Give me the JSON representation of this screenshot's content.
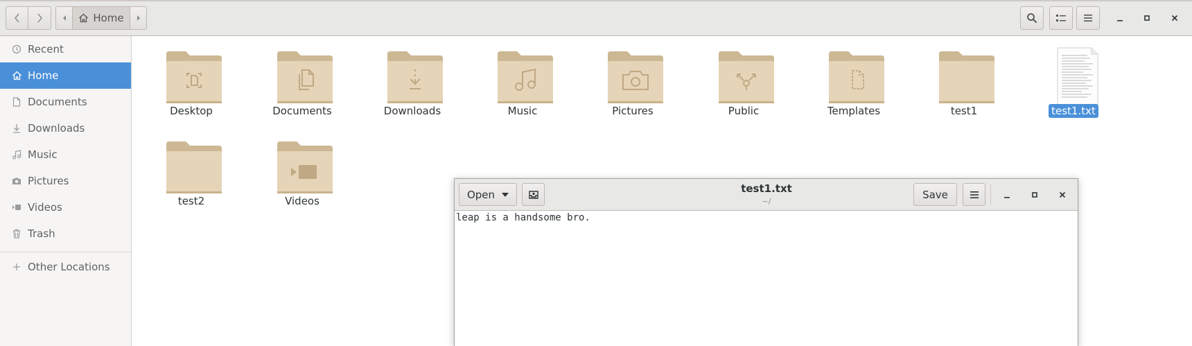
{
  "window": {
    "path_home_label": "Home"
  },
  "sidebar": {
    "items": [
      {
        "label": "Recent",
        "icon": "clock-icon"
      },
      {
        "label": "Home",
        "icon": "home-icon"
      },
      {
        "label": "Documents",
        "icon": "document-icon"
      },
      {
        "label": "Downloads",
        "icon": "download-icon"
      },
      {
        "label": "Music",
        "icon": "music-icon"
      },
      {
        "label": "Pictures",
        "icon": "camera-icon"
      },
      {
        "label": "Videos",
        "icon": "video-icon"
      },
      {
        "label": "Trash",
        "icon": "trash-icon"
      },
      {
        "label": "Other Locations",
        "icon": "plus-icon"
      }
    ],
    "active": "Home"
  },
  "files": {
    "items": [
      {
        "label": "Desktop",
        "type": "folder",
        "emblem": "desktop"
      },
      {
        "label": "Documents",
        "type": "folder",
        "emblem": "documents"
      },
      {
        "label": "Downloads",
        "type": "folder",
        "emblem": "downloads"
      },
      {
        "label": "Music",
        "type": "folder",
        "emblem": "music"
      },
      {
        "label": "Pictures",
        "type": "folder",
        "emblem": "pictures"
      },
      {
        "label": "Public",
        "type": "folder",
        "emblem": "public"
      },
      {
        "label": "Templates",
        "type": "folder",
        "emblem": "templates"
      },
      {
        "label": "test1",
        "type": "folder",
        "emblem": "none"
      },
      {
        "label": "test1.txt",
        "type": "text-file",
        "selected": true
      },
      {
        "label": "test2",
        "type": "folder",
        "emblem": "none"
      },
      {
        "label": "Videos",
        "type": "folder",
        "emblem": "videos"
      }
    ]
  },
  "editor": {
    "open_label": "Open",
    "save_label": "Save",
    "title": "test1.txt",
    "subtitle": "~/",
    "content": "leap is a handsome bro."
  },
  "colors": {
    "accent": "#4a90d9",
    "folder": "#e6d4b8",
    "folder_tab": "#cdb894"
  }
}
